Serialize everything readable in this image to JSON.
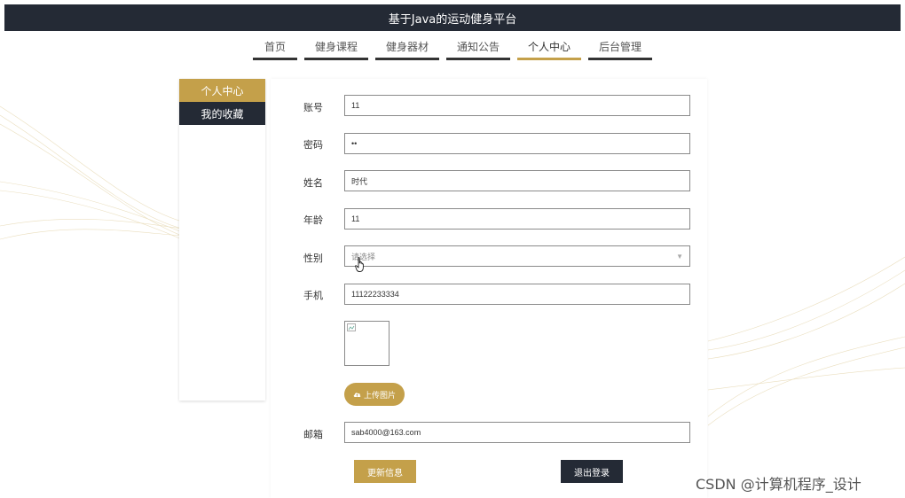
{
  "header": {
    "title": "基于Java的运动健身平台"
  },
  "nav": {
    "items": [
      {
        "label": "首页"
      },
      {
        "label": "健身课程"
      },
      {
        "label": "健身器材"
      },
      {
        "label": "通知公告"
      },
      {
        "label": "个人中心"
      },
      {
        "label": "后台管理"
      }
    ],
    "active": "个人中心"
  },
  "sidebar": {
    "items": [
      {
        "label": "个人中心"
      },
      {
        "label": "我的收藏"
      }
    ]
  },
  "form": {
    "account": {
      "label": "账号",
      "value": "11"
    },
    "password": {
      "label": "密码",
      "value": "••"
    },
    "name": {
      "label": "姓名",
      "value": "时代"
    },
    "age": {
      "label": "年龄",
      "value": "11"
    },
    "gender": {
      "label": "性别",
      "placeholder": "请选择"
    },
    "phone": {
      "label": "手机",
      "value": "11122233334"
    },
    "upload_label": "上传图片",
    "email": {
      "label": "邮箱",
      "value": "sab4000@163.com"
    }
  },
  "actions": {
    "update_label": "更新信息",
    "logout_label": "退出登录"
  },
  "watermark": "CSDN @计算机程序_设计",
  "colors": {
    "accent": "#c4a04a",
    "dark": "#242a35"
  }
}
